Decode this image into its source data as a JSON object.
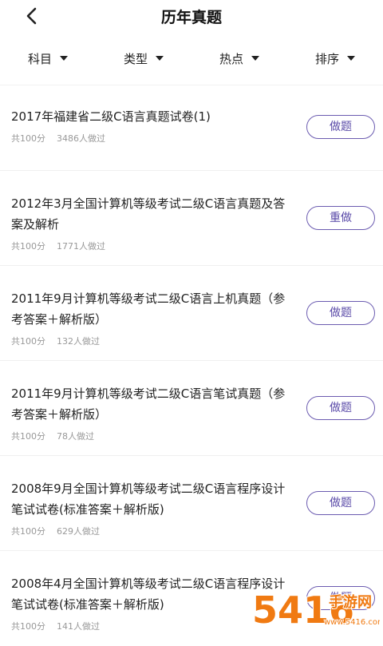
{
  "header": {
    "title": "历年真题"
  },
  "filters": [
    {
      "label": "科目"
    },
    {
      "label": "类型"
    },
    {
      "label": "热点"
    },
    {
      "label": "排序"
    }
  ],
  "items": [
    {
      "title": "2017年福建省二级C语言真题试卷(1)",
      "total": "共100分",
      "done": "3486人做过",
      "action": "做题"
    },
    {
      "title": "2012年3月全国计算机等级考试二级C语言真题及答案及解析",
      "total": "共100分",
      "done": "1771人做过",
      "action": "重做"
    },
    {
      "title": "2011年9月计算机等级考试二级C语言上机真题（参考答案＋解析版）",
      "total": "共100分",
      "done": "132人做过",
      "action": "做题"
    },
    {
      "title": "2011年9月计算机等级考试二级C语言笔试真题（参考答案＋解析版）",
      "total": "共100分",
      "done": "78人做过",
      "action": "做题"
    },
    {
      "title": "2008年9月全国计算机等级考试二级C语言程序设计笔试试卷(标准答案＋解析版)",
      "total": "共100分",
      "done": "629人做过",
      "action": "做题"
    },
    {
      "title": "2008年4月全国计算机等级考试二级C语言程序设计笔试试卷(标准答案＋解析版)",
      "total": "共100分",
      "done": "141人做过",
      "action": "做题"
    }
  ],
  "watermark": {
    "logo": "5416",
    "site": "手游网",
    "url": "www.5416.com"
  },
  "colors": {
    "accent": "#6b5bb0",
    "meta": "#999999",
    "watermark_orange": "#f07a12"
  }
}
